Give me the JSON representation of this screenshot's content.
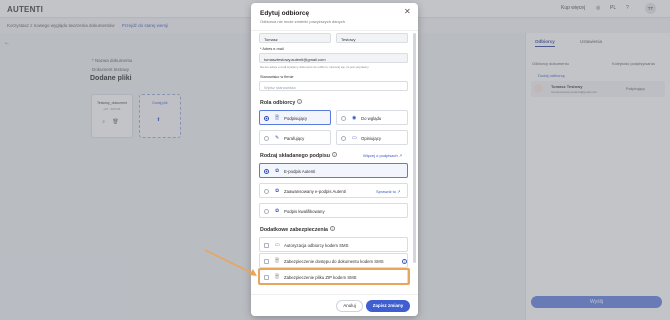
{
  "app": {
    "logo": "AUTENTI"
  },
  "topbar": {
    "buy_more": "Kup więcej",
    "lang": "PL",
    "avatar_initials": "TT"
  },
  "notice": {
    "text": "Korzystasz z nowego wyglądu tworzenia dokumentów",
    "link": "Przejdź do starej wersji"
  },
  "background": {
    "doc_name_label": "* Nazwa dokumentu",
    "doc_name_value": "Dokument testowy",
    "add_files_title": "Dodane pliki",
    "file_name": "Testowy_dokument",
    "file_sub": "pdf · 200 KB",
    "add_file_label": "Dodaj plik"
  },
  "right_panel": {
    "tabs": [
      "Odbiorcy",
      "Ustawienia"
    ],
    "recipients_label": "Odbiorcy dokumentu",
    "order_label": "Kolejność podpisywania",
    "add_recipient": "Dodaj odbiorcę",
    "recipient_name": "Tomasz Testowy",
    "recipient_email": "tomasztestowy.autenti@gmail.com",
    "recipient_role": "Podpisujący",
    "send_button": "Wyślij"
  },
  "modal": {
    "title": "Edytuj odbiorcę",
    "subtitle": "Odbiorca nie może zmienić powyższych danych",
    "first_name": "Tomasz",
    "last_name": "Testowy",
    "email_label": "* Adres e-mail",
    "email_value": "tomasztestowy.autenti@gmail.com",
    "email_hint": "Na ten adres e-mail wyślemy dokument do odbioru. Upewnij się, że jest poprawny",
    "position_label": "Stanowisko w firmie",
    "position_placeholder": "Wpisz stanowisko",
    "role_section": "Rola odbiorcy",
    "roles": [
      {
        "label": "Podpisujący",
        "icon": "signer-icon",
        "selected": true
      },
      {
        "label": "Do wglądu",
        "icon": "eye-icon",
        "selected": false
      },
      {
        "label": "Parafujący",
        "icon": "initials-icon",
        "selected": false
      },
      {
        "label": "Opiniujący",
        "icon": "comment-icon",
        "selected": false
      }
    ],
    "signature_section": "Rodzaj składanego podpisu",
    "signature_link": "Więcej o podpisach",
    "signatures": [
      {
        "label": "E-podpis Autenti",
        "selected": true
      },
      {
        "label": "Zaawansowany e-podpis Autenti",
        "selected": false,
        "link": "Sprawdź to"
      },
      {
        "label": "Podpis kwalifikowany",
        "selected": false
      }
    ],
    "security_section": "Dodatkowe zabezpieczenia",
    "security_options": [
      "Autoryzacja odbiorcy kodem SMS",
      "Zabezpieczenie dostępu do dokumentu kodem SMS",
      "Zabezpieczenie pliku ZIP kodem SMS"
    ],
    "cancel_button": "Anuluj",
    "save_button": "Zapisz zmiany"
  },
  "colors": {
    "accent": "#3f5fd0",
    "highlight": "#e9a55c",
    "overlay": "#787c86"
  }
}
